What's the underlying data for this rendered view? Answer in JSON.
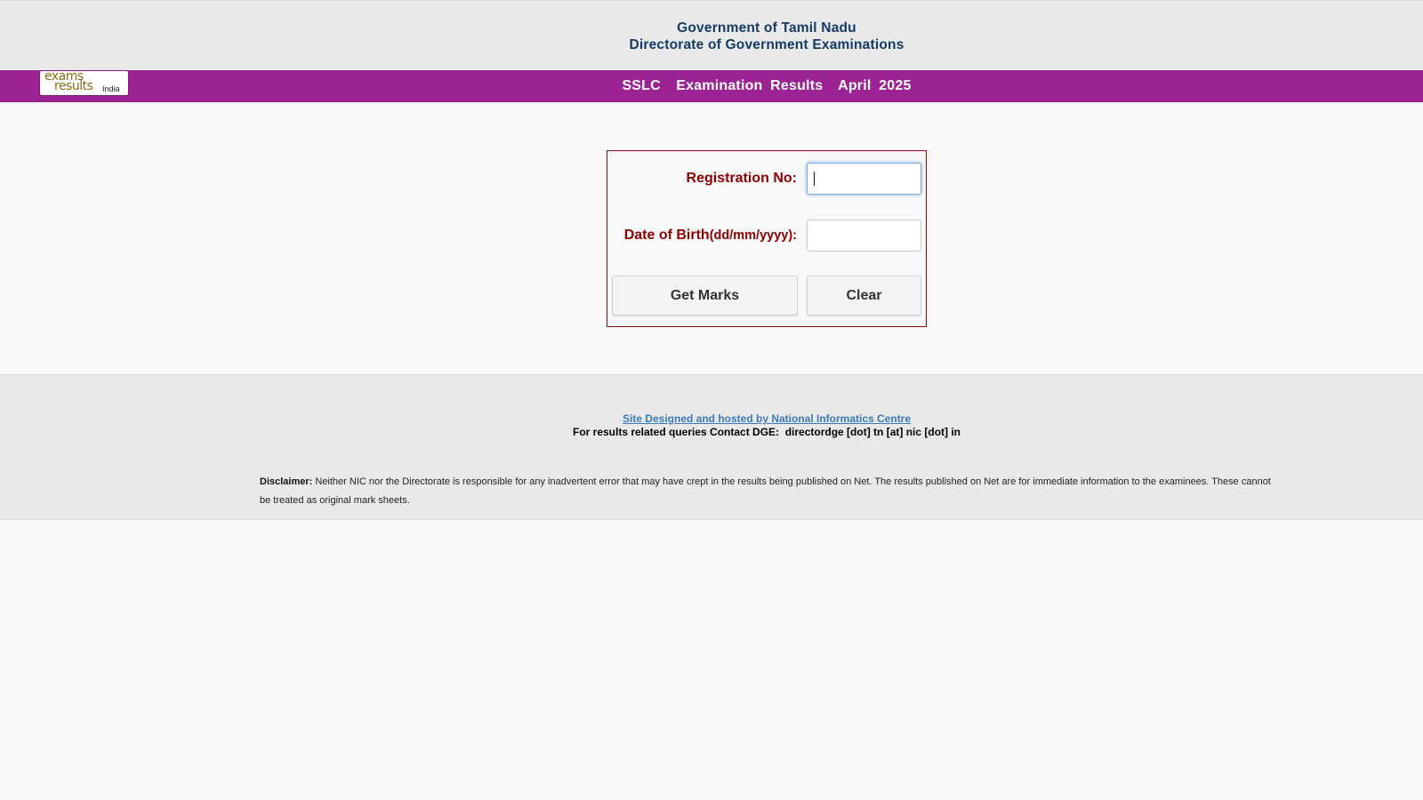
{
  "header": {
    "line1": "Government of Tamil Nadu",
    "line2": "Directorate of Government Examinations"
  },
  "banner": {
    "logo": {
      "word1": "exams",
      "word2": "results",
      "word3": "India"
    },
    "title": "SSLC  Examination Results  April 2025"
  },
  "form": {
    "registration_label": "Registration No:",
    "registration_value": "",
    "dob_label": "Date of Birth",
    "dob_format": "(dd/mm/yyyy):",
    "dob_value": "",
    "get_marks_label": "Get Marks",
    "clear_label": "Clear"
  },
  "footer": {
    "credit_link": "Site Designed and hosted by National Informatics Centre",
    "contact": "For results related queries Contact DGE:  directordge [dot] tn [at] nic [dot] in",
    "disclaimer_label": "Disclaimer:",
    "disclaimer_text": "Neither NIC nor the Directorate is responsible for any inadvertent error that may have crept in the results being published on Net. The results published on Net are for immediate information to the examinees. These cannot be treated as original mark sheets."
  },
  "colors": {
    "banner": "#9b2394",
    "header_text": "#143a66",
    "label": "#8b0000",
    "link": "#3a7ab8"
  }
}
